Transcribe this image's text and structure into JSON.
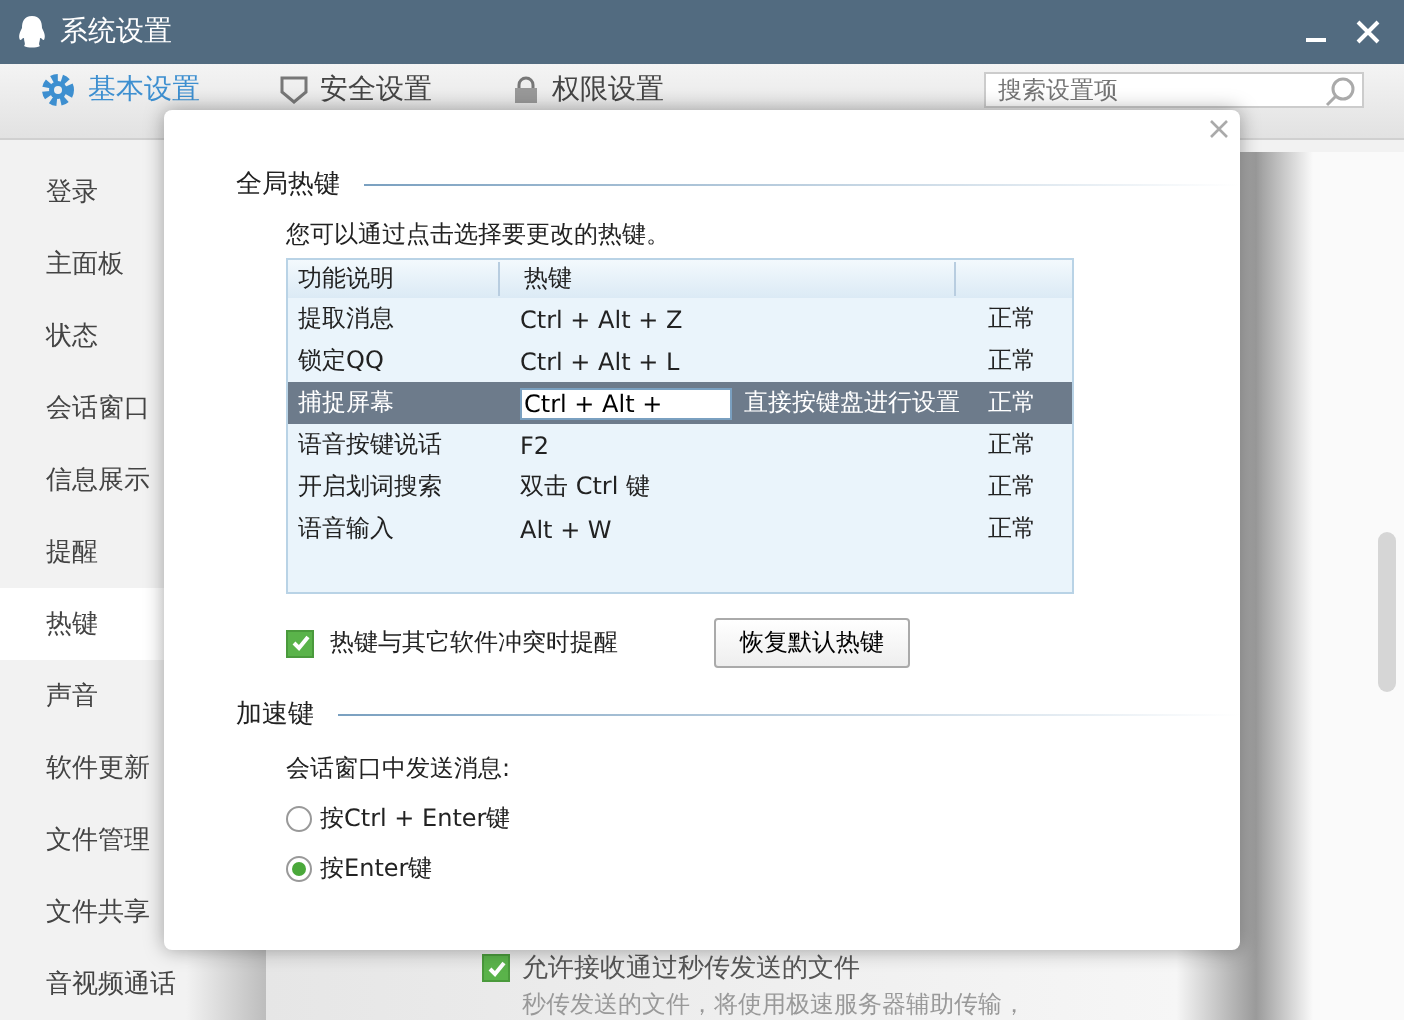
{
  "window": {
    "title": "系统设置"
  },
  "tabs": [
    {
      "label": "基本设置",
      "selected": true
    },
    {
      "label": "安全设置",
      "selected": false
    },
    {
      "label": "权限设置",
      "selected": false
    }
  ],
  "search": {
    "placeholder": "搜索设置项"
  },
  "sidebar": {
    "items": [
      {
        "label": "登录",
        "selected": false
      },
      {
        "label": "主面板",
        "selected": false
      },
      {
        "label": "状态",
        "selected": false
      },
      {
        "label": "会话窗口",
        "selected": false
      },
      {
        "label": "信息展示",
        "selected": false
      },
      {
        "label": "提醒",
        "selected": false
      },
      {
        "label": "热键",
        "selected": true
      },
      {
        "label": "声音",
        "selected": false
      },
      {
        "label": "软件更新",
        "selected": false
      },
      {
        "label": "文件管理",
        "selected": false
      },
      {
        "label": "文件共享",
        "selected": false
      },
      {
        "label": "音视频通话",
        "selected": false
      }
    ]
  },
  "background": {
    "checkbox": {
      "label": "允许接收通过秒传发送的文件",
      "checked": true
    },
    "note": "秒传发送的文件，将使用极速服务器辅助传输，"
  },
  "dialog": {
    "global_hotkeys": {
      "heading": "全局热键",
      "hint": "您可以通过点击选择要更改的热键。",
      "table": {
        "columns": [
          "功能说明",
          "热键"
        ],
        "rows": [
          {
            "kind": "normal",
            "function": "提取消息",
            "hotkey": "Ctrl + Alt + Z",
            "status": "正常",
            "selected": false
          },
          {
            "kind": "normal",
            "function": "锁定QQ",
            "hotkey": "Ctrl + Alt + L",
            "status": "正常",
            "selected": false
          },
          {
            "kind": "editing",
            "function": "捕捉屏幕",
            "hotkey": "Ctrl + Alt + ",
            "hint": "直接按键盘进行设置",
            "status": "正常",
            "selected": true
          },
          {
            "kind": "normal",
            "function": "语音按键说话",
            "hotkey": "F2",
            "status": "正常",
            "selected": false
          },
          {
            "kind": "normal",
            "function": "开启划词搜索",
            "hotkey": "双击 Ctrl 键",
            "status": "正常",
            "selected": false
          },
          {
            "kind": "normal",
            "function": "语音输入",
            "hotkey": "Alt + W",
            "status": "正常",
            "selected": false
          }
        ]
      },
      "conflict_alert": {
        "label": "热键与其它软件冲突时提醒",
        "checked": true
      },
      "restore_button": "恢复默认热键"
    },
    "shortcut_keys": {
      "heading": "加速键",
      "prompt": "会话窗口中发送消息:",
      "options": [
        {
          "label": "按Ctrl + Enter键",
          "selected": false
        },
        {
          "label": "按Enter键",
          "selected": true
        }
      ]
    }
  }
}
